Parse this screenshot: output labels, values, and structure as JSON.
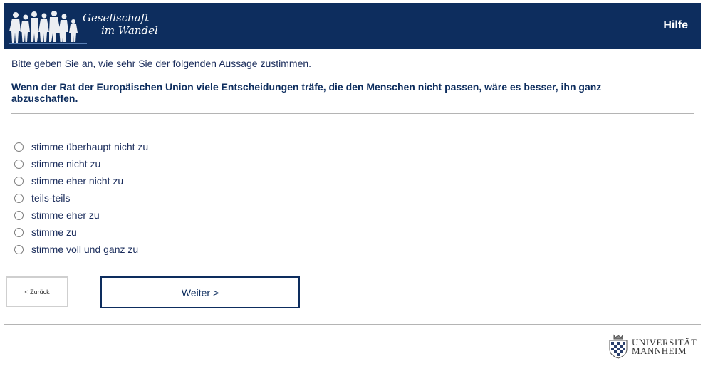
{
  "header": {
    "logo_line1": "Gesellschaft",
    "logo_line2": "im Wandel",
    "help_label": "Hilfe",
    "background_color": "#0d2d5e"
  },
  "survey": {
    "instruction": "Bitte geben Sie an, wie sehr Sie der folgenden Aussage zustimmen.",
    "question": "Wenn der Rat der Europäischen Union viele Entscheidungen träfe, die den Menschen nicht passen, wäre es besser, ihn ganz abzuschaffen.",
    "options": [
      {
        "label": "stimme überhaupt nicht zu"
      },
      {
        "label": "stimme nicht zu"
      },
      {
        "label": "stimme eher nicht zu"
      },
      {
        "label": "teils-teils"
      },
      {
        "label": "stimme eher zu"
      },
      {
        "label": "stimme zu"
      },
      {
        "label": "stimme voll und ganz zu"
      }
    ]
  },
  "navigation": {
    "back_label": "< Zurück",
    "next_label": "Weiter >"
  },
  "footer": {
    "university_line1": "UNIVERSITÄT",
    "university_line2": "MANNHEIM"
  }
}
